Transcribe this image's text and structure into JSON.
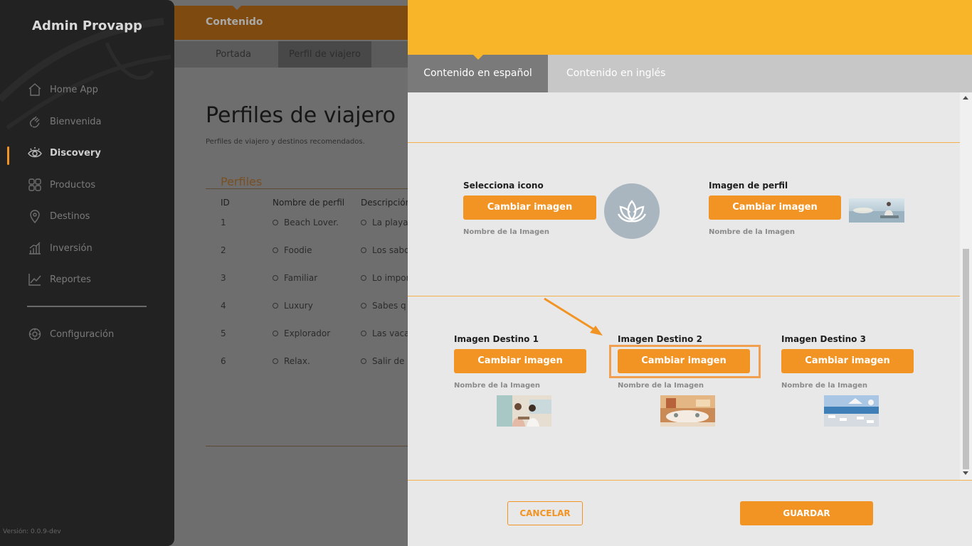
{
  "sidebar": {
    "brand": "Admin Provapp",
    "items": [
      {
        "label": "Home App",
        "icon": "home-icon"
      },
      {
        "label": "Bienvenida",
        "icon": "wave-hand-icon"
      },
      {
        "label": "Discovery",
        "icon": "eye-icon",
        "active": true
      },
      {
        "label": "Productos",
        "icon": "grid-icon"
      },
      {
        "label": "Destinos",
        "icon": "map-pin-icon"
      },
      {
        "label": "Inversión",
        "icon": "bar-chart-icon"
      },
      {
        "label": "Reportes",
        "icon": "line-chart-icon"
      }
    ],
    "settings": {
      "label": "Configuración",
      "icon": "gear-icon"
    },
    "version": "Versión: 0.0.9-dev"
  },
  "main": {
    "header_title": "Contenido",
    "subtabs": [
      "Portada",
      "Perfil de viajero"
    ],
    "page_title": "Perfiles de viajero",
    "page_subtitle": "Perfiles de viajero y destinos recomendados.",
    "section_label": "Perfiles",
    "table": {
      "headers": [
        "ID",
        "Nombre de perfil",
        "Descripción"
      ],
      "rows": [
        {
          "id": "1",
          "name": "Beach Lover.",
          "desc": "La playa"
        },
        {
          "id": "2",
          "name": "Foodie",
          "desc": "Los sabo"
        },
        {
          "id": "3",
          "name": "Familiar",
          "desc": "Lo impor"
        },
        {
          "id": "4",
          "name": "Luxury",
          "desc": "Sabes q"
        },
        {
          "id": "5",
          "name": "Explorador",
          "desc": "Las vaca"
        },
        {
          "id": "6",
          "name": "Relax.",
          "desc": "Salir de l"
        }
      ]
    }
  },
  "panel": {
    "tabs": [
      "Contenido en español",
      "Contenido en inglés"
    ],
    "icon_block": {
      "label": "Selecciona icono",
      "button": "Cambiar imagen",
      "note": "Nombre de la Imagen",
      "icon": "lotus-icon"
    },
    "profile_image": {
      "label": "Imagen de perfil",
      "button": "Cambiar imagen",
      "note": "Nombre de la Imagen"
    },
    "destinations": [
      {
        "label": "Imagen Destino 1",
        "button": "Cambiar imagen",
        "note": "Nombre de la Imagen"
      },
      {
        "label": "Imagen Destino 2",
        "button": "Cambiar imagen",
        "note": "Nombre de la Imagen"
      },
      {
        "label": "Imagen Destino 3",
        "button": "Cambiar imagen",
        "note": "Nombre de la Imagen"
      }
    ],
    "cancel_label": "CANCELAR",
    "save_label": "GUARDAR"
  },
  "colors": {
    "accent": "#f29423",
    "header": "#f9b52a",
    "sidebar": "#222222"
  }
}
